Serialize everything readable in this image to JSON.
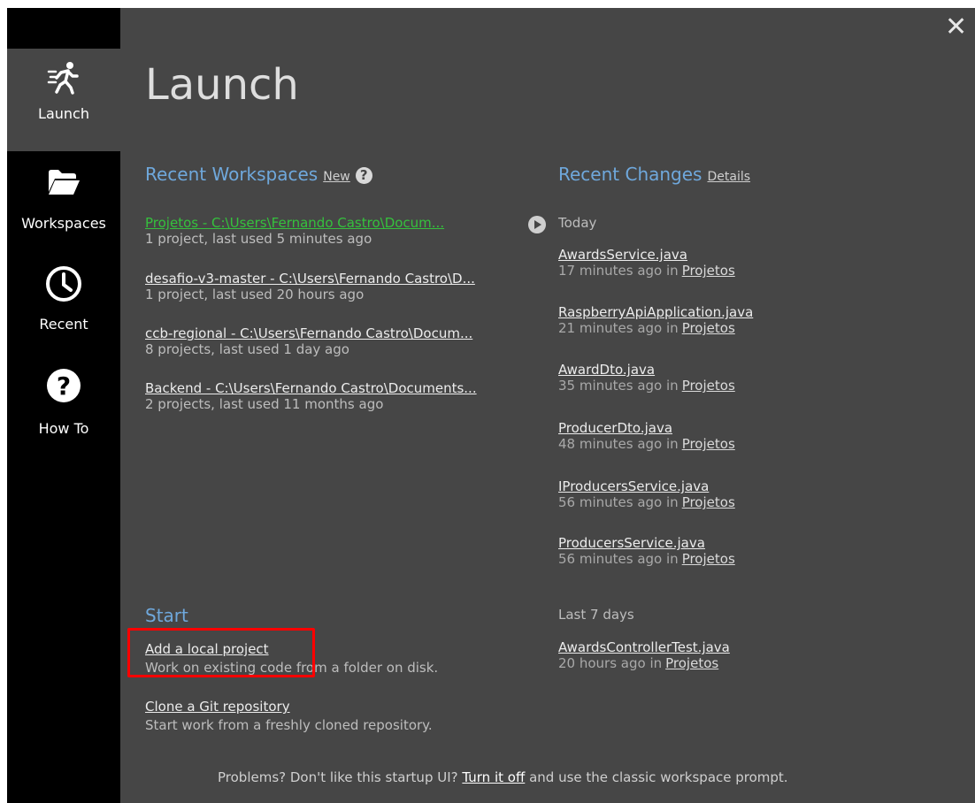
{
  "window": {
    "close_glyph": "✕",
    "accent": "#6fa8dc",
    "highlight_color": "#ff0000"
  },
  "sidebar": {
    "items": [
      {
        "label": "Launch",
        "icon": "running-person-icon",
        "active": true
      },
      {
        "label": "Workspaces",
        "icon": "folder-icon",
        "active": false
      },
      {
        "label": "Recent",
        "icon": "clock-icon",
        "active": false
      },
      {
        "label": "How To",
        "icon": "help-icon",
        "active": false
      }
    ]
  },
  "page": {
    "title": "Launch"
  },
  "recent_workspaces": {
    "heading": "Recent Workspaces",
    "new_link": "New",
    "help_glyph": "?",
    "items": [
      {
        "link": "Projetos - C:\\Users\\Fernando Castro\\Docum...",
        "desc": "1 project, last used 5 minutes ago"
      },
      {
        "link": "desafio-v3-master - C:\\Users\\Fernando Castro\\D...",
        "desc": "1 project, last used 20 hours ago"
      },
      {
        "link": "ccb-regional - C:\\Users\\Fernando Castro\\Docum...",
        "desc": "8 projects, last used 1 day ago"
      },
      {
        "link": "Backend - C:\\Users\\Fernando Castro\\Documents...",
        "desc": "2 projects, last used 11 months ago"
      }
    ]
  },
  "recent_changes": {
    "heading": "Recent Changes",
    "details_link": "Details",
    "groups": [
      {
        "label": "Today",
        "items": [
          {
            "file": "AwardsService.java",
            "time": "17 minutes ago in",
            "project": "Projetos"
          },
          {
            "file": "RaspberryApiApplication.java",
            "time": "21 minutes ago in",
            "project": "Projetos"
          },
          {
            "file": "AwardDto.java",
            "time": "35 minutes ago in",
            "project": "Projetos"
          },
          {
            "file": "ProducerDto.java",
            "time": "48 minutes ago in",
            "project": "Projetos"
          },
          {
            "file": "IProducersService.java",
            "time": "56 minutes ago in",
            "project": "Projetos"
          },
          {
            "file": "ProducersService.java",
            "time": "56 minutes ago in",
            "project": "Projetos"
          }
        ]
      },
      {
        "label": "Last 7 days",
        "items": [
          {
            "file": "AwardsControllerTest.java",
            "time": "20 hours ago in",
            "project": "Projetos"
          }
        ]
      }
    ]
  },
  "start": {
    "heading": "Start",
    "items": [
      {
        "link": "Add a local project",
        "desc": "Work on existing code from a folder on disk."
      },
      {
        "link": "Clone a Git repository",
        "desc": "Start work from a freshly cloned repository."
      }
    ]
  },
  "footer": {
    "before": "Problems? Don't like this startup UI?",
    "link": "Turn it off",
    "after": "and use the classic workspace prompt."
  }
}
